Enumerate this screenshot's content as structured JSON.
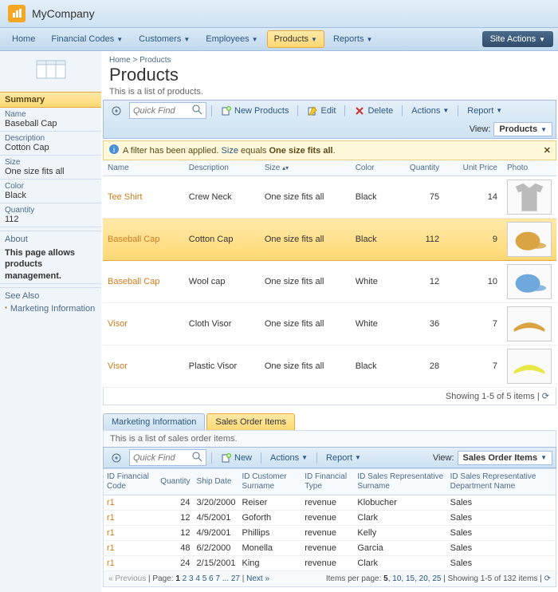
{
  "app": {
    "company": "MyCompany"
  },
  "nav": {
    "items": [
      {
        "label": "Home",
        "dropdown": false
      },
      {
        "label": "Financial Codes",
        "dropdown": true
      },
      {
        "label": "Customers",
        "dropdown": true
      },
      {
        "label": "Employees",
        "dropdown": true
      },
      {
        "label": "Products",
        "dropdown": true,
        "active": true
      },
      {
        "label": "Reports",
        "dropdown": true
      }
    ],
    "site_actions": "Site Actions"
  },
  "breadcrumb": {
    "home": "Home",
    "sep": ">",
    "current": "Products"
  },
  "page": {
    "title": "Products",
    "desc": "This is a list of products."
  },
  "sidebar": {
    "summary_title": "Summary",
    "fields": [
      {
        "label": "Name",
        "value": "Baseball Cap"
      },
      {
        "label": "Description",
        "value": "Cotton Cap"
      },
      {
        "label": "Size",
        "value": "One size fits all"
      },
      {
        "label": "Color",
        "value": "Black"
      },
      {
        "label": "Quantity",
        "value": "112"
      }
    ],
    "about_title": "About",
    "about_text": "This page allows products management.",
    "seealso_title": "See Also",
    "seealso_link": "Marketing Information"
  },
  "toolbar": {
    "quickfind_placeholder": "Quick Find",
    "new": "New Products",
    "edit": "Edit",
    "delete": "Delete",
    "actions": "Actions",
    "report": "Report",
    "view_label": "View:",
    "view_value": "Products"
  },
  "filter": {
    "prefix": "A filter has been applied.",
    "field": "Size",
    "middle": "equals",
    "value": "One size fits all",
    "suffix": "."
  },
  "grid": {
    "headers": [
      "Name",
      "Description",
      "Size",
      "Color",
      "Quantity",
      "Unit Price",
      "Photo"
    ],
    "rows": [
      {
        "name": "Tee Shirt",
        "desc": "Crew Neck",
        "size": "One size fits all",
        "color": "Black",
        "qty": "75",
        "price": "14",
        "photo": "tee",
        "selected": false
      },
      {
        "name": "Baseball Cap",
        "desc": "Cotton Cap",
        "size": "One size fits all",
        "color": "Black",
        "qty": "112",
        "price": "9",
        "photo": "cap-tan",
        "selected": true
      },
      {
        "name": "Baseball Cap",
        "desc": "Wool cap",
        "size": "One size fits all",
        "color": "White",
        "qty": "12",
        "price": "10",
        "photo": "cap-blue",
        "selected": false
      },
      {
        "name": "Visor",
        "desc": "Cloth Visor",
        "size": "One size fits all",
        "color": "White",
        "qty": "36",
        "price": "7",
        "photo": "visor-tan",
        "selected": false
      },
      {
        "name": "Visor",
        "desc": "Plastic Visor",
        "size": "One size fits all",
        "color": "Black",
        "qty": "28",
        "price": "7",
        "photo": "visor-yellow",
        "selected": false
      }
    ],
    "showing": "Showing 1-5 of 5 items"
  },
  "tabs": {
    "items": [
      {
        "label": "Marketing Information",
        "active": false
      },
      {
        "label": "Sales Order Items",
        "active": true
      }
    ]
  },
  "sub": {
    "desc": "This is a list of sales order items.",
    "toolbar": {
      "quickfind_placeholder": "Quick Find",
      "new": "New",
      "actions": "Actions",
      "report": "Report",
      "view_label": "View:",
      "view_value": "Sales Order Items"
    },
    "headers": [
      "ID Financial Code",
      "Quantity",
      "Ship Date",
      "ID Customer Surname",
      "ID Financial Type",
      "ID Sales Representative Surname",
      "ID Sales Representative Department Name"
    ],
    "rows": [
      {
        "c0": "r1",
        "c1": "24",
        "c2": "3/20/2000",
        "c3": "Reiser",
        "c4": "revenue",
        "c5": "Klobucher",
        "c6": "Sales"
      },
      {
        "c0": "r1",
        "c1": "12",
        "c2": "4/5/2001",
        "c3": "Goforth",
        "c4": "revenue",
        "c5": "Clark",
        "c6": "Sales"
      },
      {
        "c0": "r1",
        "c1": "12",
        "c2": "4/9/2001",
        "c3": "Phillips",
        "c4": "revenue",
        "c5": "Kelly",
        "c6": "Sales"
      },
      {
        "c0": "r1",
        "c1": "48",
        "c2": "6/2/2000",
        "c3": "Monella",
        "c4": "revenue",
        "c5": "Garcia",
        "c6": "Sales"
      },
      {
        "c0": "r1",
        "c1": "24",
        "c2": "2/15/2001",
        "c3": "King",
        "c4": "revenue",
        "c5": "Clark",
        "c6": "Sales"
      }
    ],
    "pager": {
      "prev": "« Previous",
      "page_label": "Page:",
      "pages": [
        "1",
        "2",
        "3",
        "4",
        "5",
        "6",
        "7",
        "...",
        "27"
      ],
      "next": "Next »",
      "ipp_label": "Items per page:",
      "ipp": [
        "5",
        "10",
        "15",
        "20",
        "25"
      ],
      "showing": "Showing 1-5 of 132 items"
    }
  }
}
